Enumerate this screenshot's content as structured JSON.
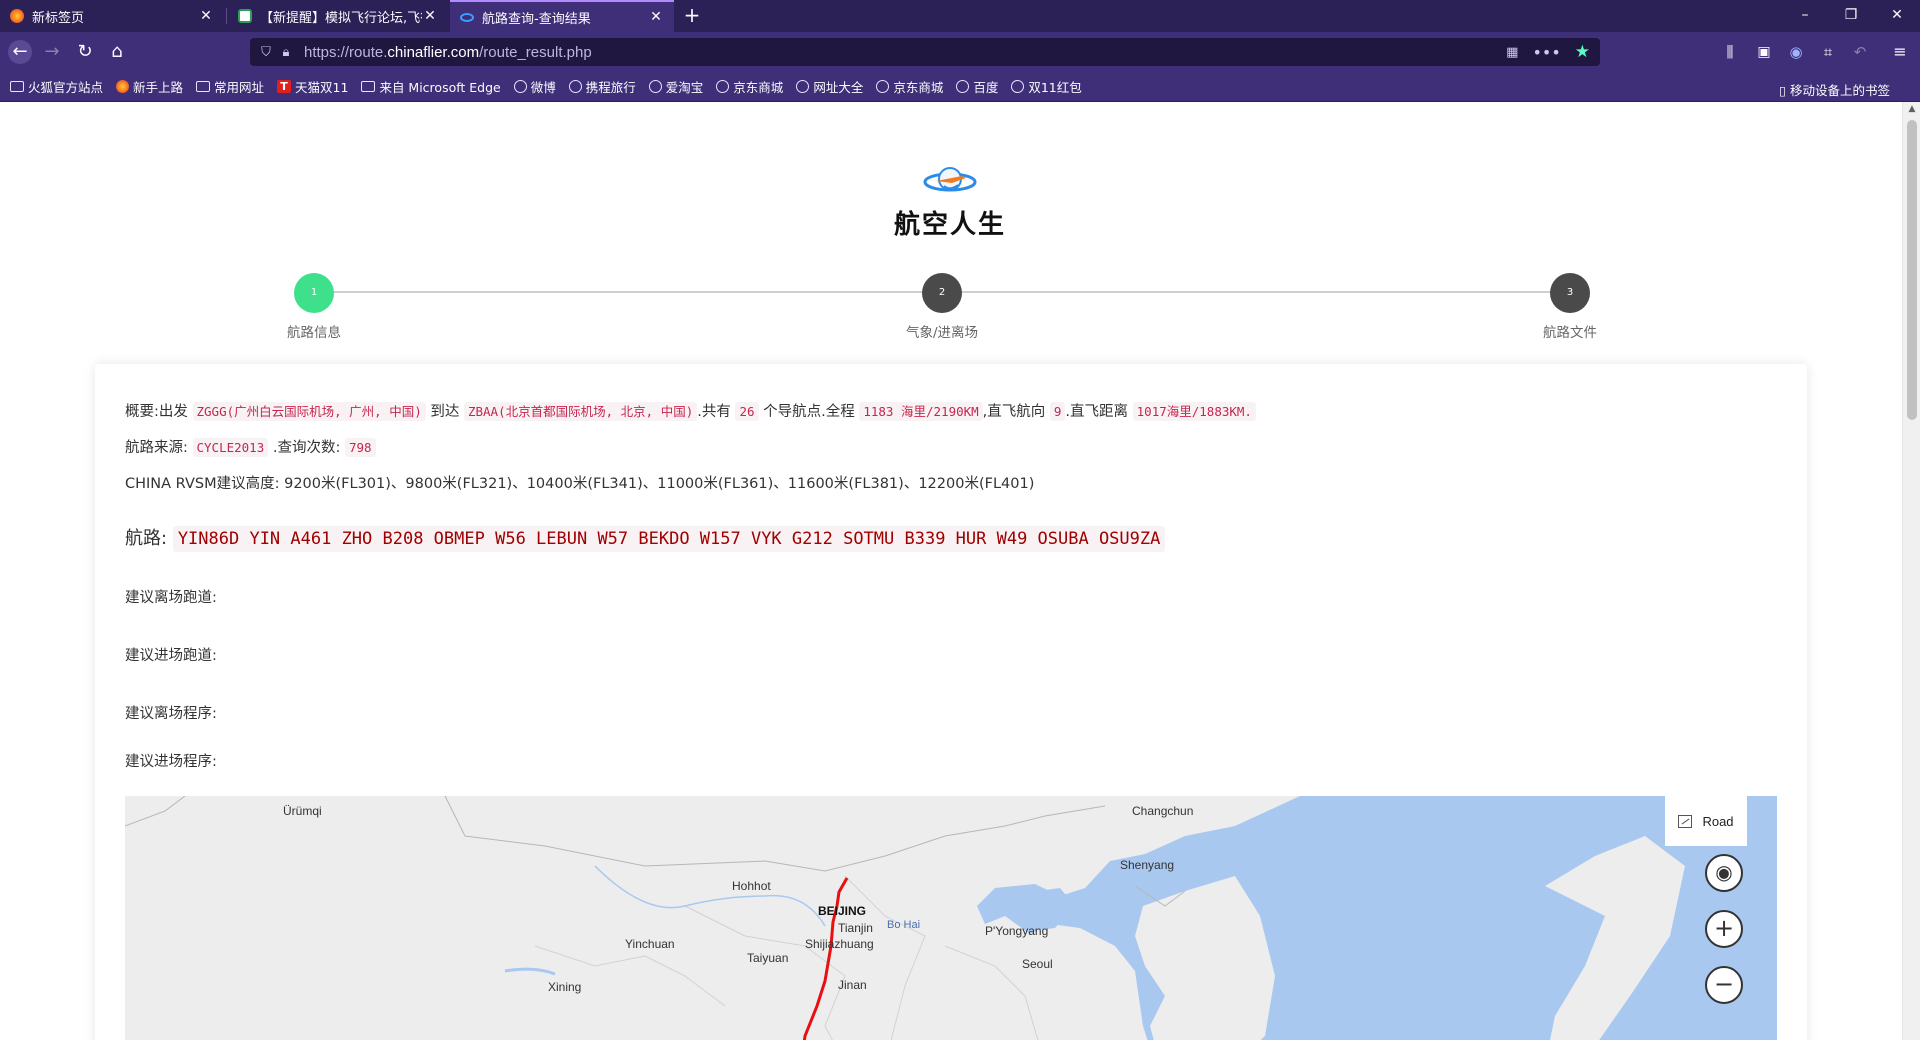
{
  "browser": {
    "tabs": [
      {
        "title": "新标签页",
        "active": false
      },
      {
        "title": "【新提醒】模拟飞行论坛,飞行模",
        "active": false
      },
      {
        "title": "航路查询-查询结果",
        "active": true
      }
    ],
    "url_prefix": "https://route.",
    "url_domain": "chinaflier.com",
    "url_path": "/route_result.php",
    "bookmarks": [
      {
        "label": "火狐官方站点",
        "icon": "folder-icon"
      },
      {
        "label": "新手上路",
        "icon": "firefox-icon"
      },
      {
        "label": "常用网址",
        "icon": "folder-icon"
      },
      {
        "label": "天猫双11",
        "icon": "tmall-icon"
      },
      {
        "label": "来自 Microsoft Edge",
        "icon": "folder-icon"
      },
      {
        "label": "微博",
        "icon": "globe-icon"
      },
      {
        "label": "携程旅行",
        "icon": "globe-icon"
      },
      {
        "label": "爱淘宝",
        "icon": "globe-icon"
      },
      {
        "label": "京东商城",
        "icon": "globe-icon"
      },
      {
        "label": "网址大全",
        "icon": "globe-icon"
      },
      {
        "label": "京东商城",
        "icon": "globe-icon"
      },
      {
        "label": "百度",
        "icon": "globe-icon"
      },
      {
        "label": "双11红包",
        "icon": "globe-icon"
      }
    ],
    "mobile_bookmarks": "移动设备上的书签",
    "accent_color": "#54ffbd",
    "theme_color": "#3e2f78"
  },
  "site": {
    "logo_text": "航空人生"
  },
  "steps": [
    {
      "number": "1",
      "label": "航路信息",
      "state": "done"
    },
    {
      "number": "2",
      "label": "气象/进离场",
      "state": "todo"
    },
    {
      "number": "3",
      "label": "航路文件",
      "state": "todo"
    }
  ],
  "summary": {
    "prefix": "概要:出发",
    "origin": "ZGGG(广州白云国际机场, 广州, 中国)",
    "to": "到达",
    "destination": "ZBAA(北京首都国际机场, 北京, 中国)",
    "waypoints_prefix": ".共有",
    "waypoints": "26",
    "waypoints_suffix": "个导航点.全程",
    "distance": "1183 海里/2190KM",
    "heading_prefix": ",直飞航向",
    "heading": "9",
    "direct_prefix": ".直飞距离",
    "direct_distance": "1017海里/1883KM."
  },
  "source": {
    "prefix": "航路来源:",
    "cycle": "CYCLE2013",
    "count_prefix": ".查询次数:",
    "count": "798"
  },
  "rvsm": "CHINA RVSM建议高度: 9200米(FL301)、9800米(FL321)、10400米(FL341)、11000米(FL361)、11600米(FL381)、12200米(FL401)",
  "route": {
    "label": "航路:",
    "value": "YIN86D YIN A461 ZHO B208 OBMEP W56 LEBUN W57 BEKDO W157 VYK G212 SOTMU B339 HUR W49 OSUBA OSU9ZA"
  },
  "suggestions": {
    "departure_runway": "建议离场跑道:",
    "arrival_runway": "建议进场跑道:",
    "departure_procedure": "建议离场程序:",
    "arrival_procedure": "建议进场程序:"
  },
  "map": {
    "style_button": "Road",
    "cities": [
      "Ürümqi",
      "Changchun",
      "Shenyang",
      "Hohhot",
      "BEIJING",
      "Tianjin",
      "P'Yongyang",
      "Shijiazhuang",
      "Yinchuan",
      "Taiyuan",
      "Seoul",
      "Xining",
      "Jinan"
    ],
    "seas": [
      "Bo Hai"
    ],
    "route_color": "#e81010"
  }
}
